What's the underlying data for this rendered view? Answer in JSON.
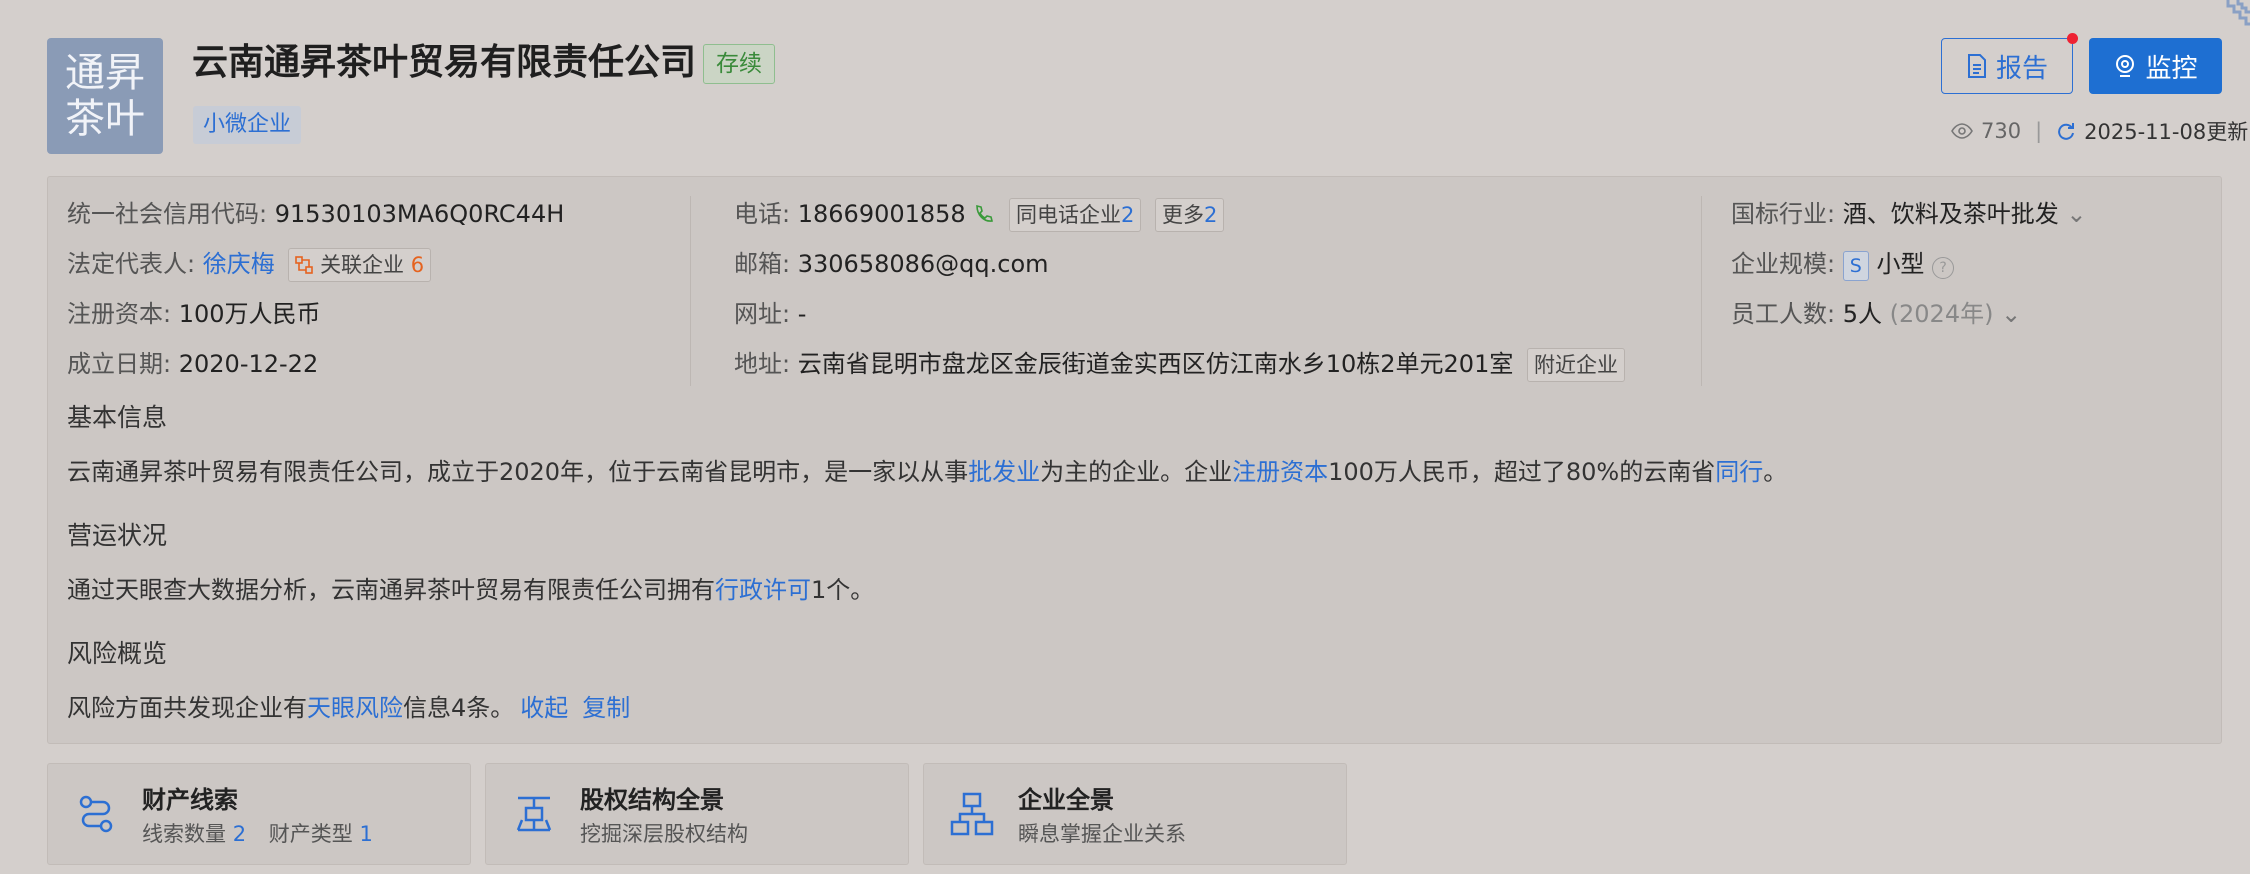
{
  "company": {
    "logo_line1": "通昇",
    "logo_line2": "茶叶",
    "name": "云南通昇茶叶贸易有限责任公司",
    "status": "存续",
    "tag": "小微企业"
  },
  "actions": {
    "report_label": "报告",
    "monitor_label": "监控",
    "views": "730",
    "updated": "2025-11-08更新"
  },
  "info": {
    "credit_code_label": "统一社会信用代码:",
    "credit_code": "91530103MA6Q0RC44H",
    "legal_rep_label": "法定代表人:",
    "legal_rep": "徐庆梅",
    "related_label": "关联企业",
    "related_count": "6",
    "capital_label": "注册资本:",
    "capital": "100万人民币",
    "founded_label": "成立日期:",
    "founded": "2020-12-22",
    "phone_label": "电话:",
    "phone": "18669001858",
    "same_phone_label": "同电话企业",
    "same_phone_count": "2",
    "more_label": "更多",
    "more_count": "2",
    "email_label": "邮箱:",
    "email": "330658086@qq.com",
    "website_label": "网址:",
    "website": "-",
    "address_label": "地址:",
    "address": "云南省昆明市盘龙区金辰街道金实西区仿江南水乡10栋2单元201室",
    "nearby_label": "附近企业",
    "industry_label": "国标行业:",
    "industry": "酒、饮料及茶叶批发",
    "scale_label": "企业规模:",
    "scale_badge": "S",
    "scale": "小型",
    "staff_label": "员工人数:",
    "staff": "5人",
    "staff_year": "(2024年)"
  },
  "sections": {
    "basic_title": "基本信息",
    "basic_p1": "云南通昇茶叶贸易有限责任公司，成立于2020年，位于云南省昆明市，是一家以从事",
    "basic_link1": "批发业",
    "basic_p2": "为主的企业。企业",
    "basic_link2": "注册资本",
    "basic_p3": "100万人民币，超过了80%的云南省",
    "basic_link3": "同行",
    "basic_p4": "。",
    "ops_title": "营运状况",
    "ops_p1": "通过天眼查大数据分析，云南通昇茶叶贸易有限责任公司拥有",
    "ops_link": "行政许可",
    "ops_p2": "1个。",
    "risk_title": "风险概览",
    "risk_p1": "风险方面共发现企业有",
    "risk_link": "天眼风险",
    "risk_p2": "信息4条。",
    "collapse": "收起",
    "copy": "复制"
  },
  "cards": [
    {
      "title": "财产线索",
      "sub1": "线索数量",
      "n1": "2",
      "sub2": "财产类型",
      "n2": "1"
    },
    {
      "title": "股权结构全景",
      "sub": "挖掘深层股权结构"
    },
    {
      "title": "企业全景",
      "sub": "瞬息掌握企业关系"
    }
  ],
  "colors": {
    "accent": "#2c6fd3",
    "status_green": "#3a8a3a",
    "logo_bg": "#8a9bb6",
    "orange": "#e5631f"
  }
}
